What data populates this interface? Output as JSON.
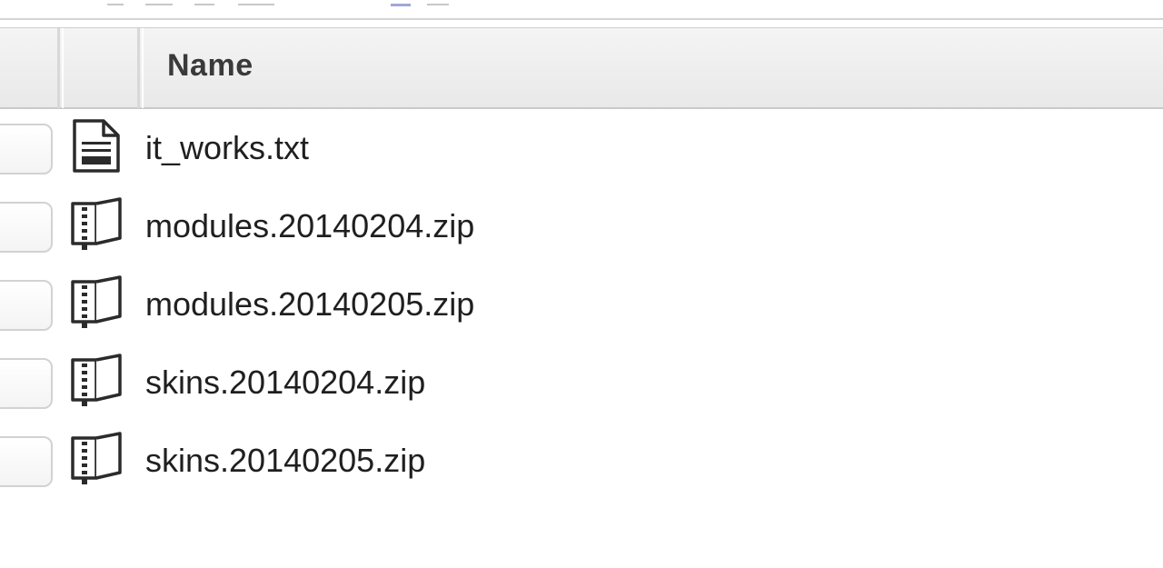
{
  "table": {
    "header": {
      "name_label": "Name"
    },
    "rows": [
      {
        "name": "it_works.txt",
        "icon": "text-file-icon"
      },
      {
        "name": "modules.20140204.zip",
        "icon": "zip-file-icon"
      },
      {
        "name": "modules.20140205.zip",
        "icon": "zip-file-icon"
      },
      {
        "name": "skins.20140204.zip",
        "icon": "zip-file-icon"
      },
      {
        "name": "skins.20140205.zip",
        "icon": "zip-file-icon"
      }
    ]
  },
  "colors": {
    "header_bg": "#eeeeee",
    "text": "#1f1f1f",
    "header_text": "#3a3a3a",
    "tab_indicator": "#9fa7d8"
  }
}
